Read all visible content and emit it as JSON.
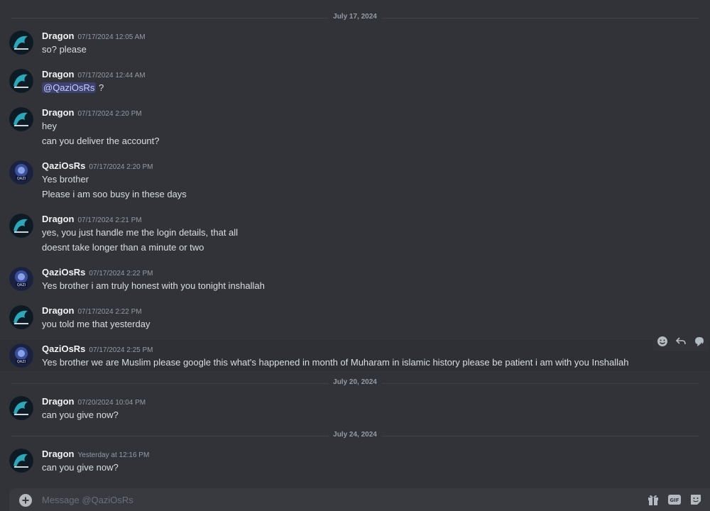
{
  "dates": [
    "July 17, 2024",
    "July 20, 2024",
    "July 24, 2024"
  ],
  "messages": [
    {
      "author": "Dragon",
      "timestamp": "07/17/2024 12:05 AM",
      "lines": [
        "so? please"
      ]
    },
    {
      "author": "Dragon",
      "timestamp": "07/17/2024 12:44 AM",
      "mention": "@QaziOsRs",
      "after_mention": " ?"
    },
    {
      "author": "Dragon",
      "timestamp": "07/17/2024 2:20 PM",
      "lines": [
        "hey",
        "can you deliver the account?"
      ]
    },
    {
      "author": "QaziOsRs",
      "timestamp": "07/17/2024 2:20 PM",
      "lines": [
        "Yes brother",
        "Please i am soo busy in these days"
      ]
    },
    {
      "author": "Dragon",
      "timestamp": "07/17/2024 2:21 PM",
      "lines": [
        "yes, you just handle me the login details, that all",
        "doesnt take longer than a minute or two"
      ]
    },
    {
      "author": "QaziOsRs",
      "timestamp": "07/17/2024 2:22 PM",
      "lines": [
        "Yes brother i am truly honest with you tonight inshallah"
      ]
    },
    {
      "author": "Dragon",
      "timestamp": "07/17/2024 2:22 PM",
      "lines": [
        "you told me that yesterday"
      ]
    },
    {
      "author": "QaziOsRs",
      "timestamp": "07/17/2024 2:25 PM",
      "lines": [
        "Yes brother we are Muslim please google this what's happened in month of Muharam in islamic history please be patient i am with you Inshallah"
      ]
    },
    {
      "author": "Dragon",
      "timestamp": "07/20/2024 10:04 PM",
      "lines": [
        "can you give now?"
      ]
    },
    {
      "author": "Dragon",
      "timestamp": "Yesterday at 12:16 PM",
      "lines": [
        "can you give now?"
      ]
    }
  ],
  "hover_toolbar": [
    "add-reaction-icon",
    "reply-icon",
    "create-thread-icon"
  ],
  "composer": {
    "placeholder": "Message @QaziOsRs",
    "icons": [
      "gift-icon",
      "gif-icon",
      "sticker-icon"
    ]
  },
  "colors": {
    "background": "#313338",
    "mention": "#5865f2",
    "author": "#f2f3f5",
    "timestamp": "#949ba4"
  }
}
